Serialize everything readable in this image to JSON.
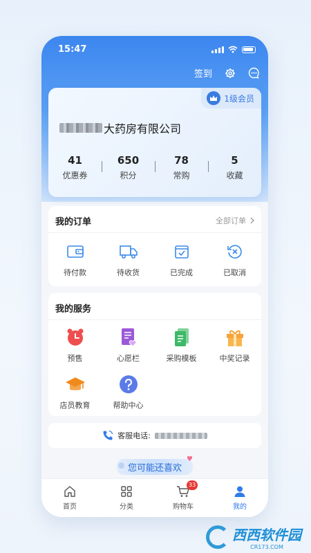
{
  "status": {
    "time": "15:47"
  },
  "header": {
    "sign_in": "签到"
  },
  "member": {
    "level": "1级会员",
    "company_suffix": "大药房有限公司",
    "stats": [
      {
        "value": "41",
        "label": "优惠券"
      },
      {
        "value": "650",
        "label": "积分"
      },
      {
        "value": "78",
        "label": "常购"
      },
      {
        "value": "5",
        "label": "收藏"
      }
    ]
  },
  "orders": {
    "title": "我的订单",
    "all_link": "全部订单",
    "items": [
      {
        "label": "待付款",
        "icon": "wallet-icon"
      },
      {
        "label": "待收货",
        "icon": "truck-icon"
      },
      {
        "label": "已完成",
        "icon": "box-check-icon"
      },
      {
        "label": "已取消",
        "icon": "cancel-icon"
      }
    ]
  },
  "services": {
    "title": "我的服务",
    "items": [
      {
        "label": "预售",
        "icon": "alarm-clock-icon"
      },
      {
        "label": "心愿栏",
        "icon": "wishlist-icon"
      },
      {
        "label": "采购模板",
        "icon": "template-icon"
      },
      {
        "label": "中奖记录",
        "icon": "gift-icon"
      },
      {
        "label": "店员教育",
        "icon": "graduation-cap-icon"
      },
      {
        "label": "帮助中心",
        "icon": "help-icon"
      }
    ]
  },
  "service_phone": {
    "label": "客服电话:"
  },
  "recommend": {
    "title": "您可能还喜欢"
  },
  "tabbar": {
    "items": [
      {
        "label": "首页",
        "icon": "home-icon"
      },
      {
        "label": "分类",
        "icon": "grid-icon"
      },
      {
        "label": "购物车",
        "icon": "cart-icon",
        "badge": "33"
      },
      {
        "label": "我的",
        "icon": "user-icon",
        "active": true
      }
    ]
  },
  "watermark": {
    "brand": "西西软件园",
    "url": "CR173.COM"
  },
  "colors": {
    "primary": "#2f7be8",
    "badge": "#e53935"
  }
}
